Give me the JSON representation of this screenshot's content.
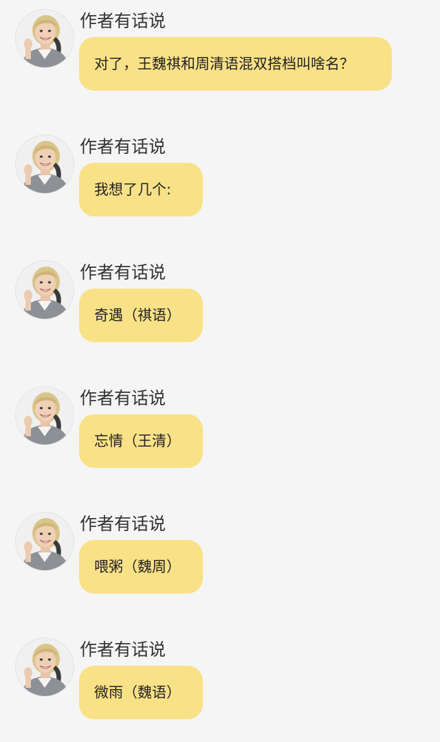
{
  "theme": {
    "background": "#f5f5f5",
    "bubble_color": "#f9e187"
  },
  "messages": [
    {
      "sender": "作者有话说",
      "avatar": "smiling-woman-avatar",
      "text": "对了，王魏祺和周清语混双搭档叫啥名？"
    },
    {
      "sender": "作者有话说",
      "avatar": "smiling-woman-avatar",
      "text": "我想了几个:"
    },
    {
      "sender": "作者有话说",
      "avatar": "smiling-woman-avatar",
      "text": "奇遇（祺语）"
    },
    {
      "sender": "作者有话说",
      "avatar": "smiling-woman-avatar",
      "text": "忘情（王清）"
    },
    {
      "sender": "作者有话说",
      "avatar": "smiling-woman-avatar",
      "text": "喂粥（魏周）"
    },
    {
      "sender": "作者有话说",
      "avatar": "smiling-woman-avatar",
      "text": "微雨（魏语）"
    }
  ]
}
